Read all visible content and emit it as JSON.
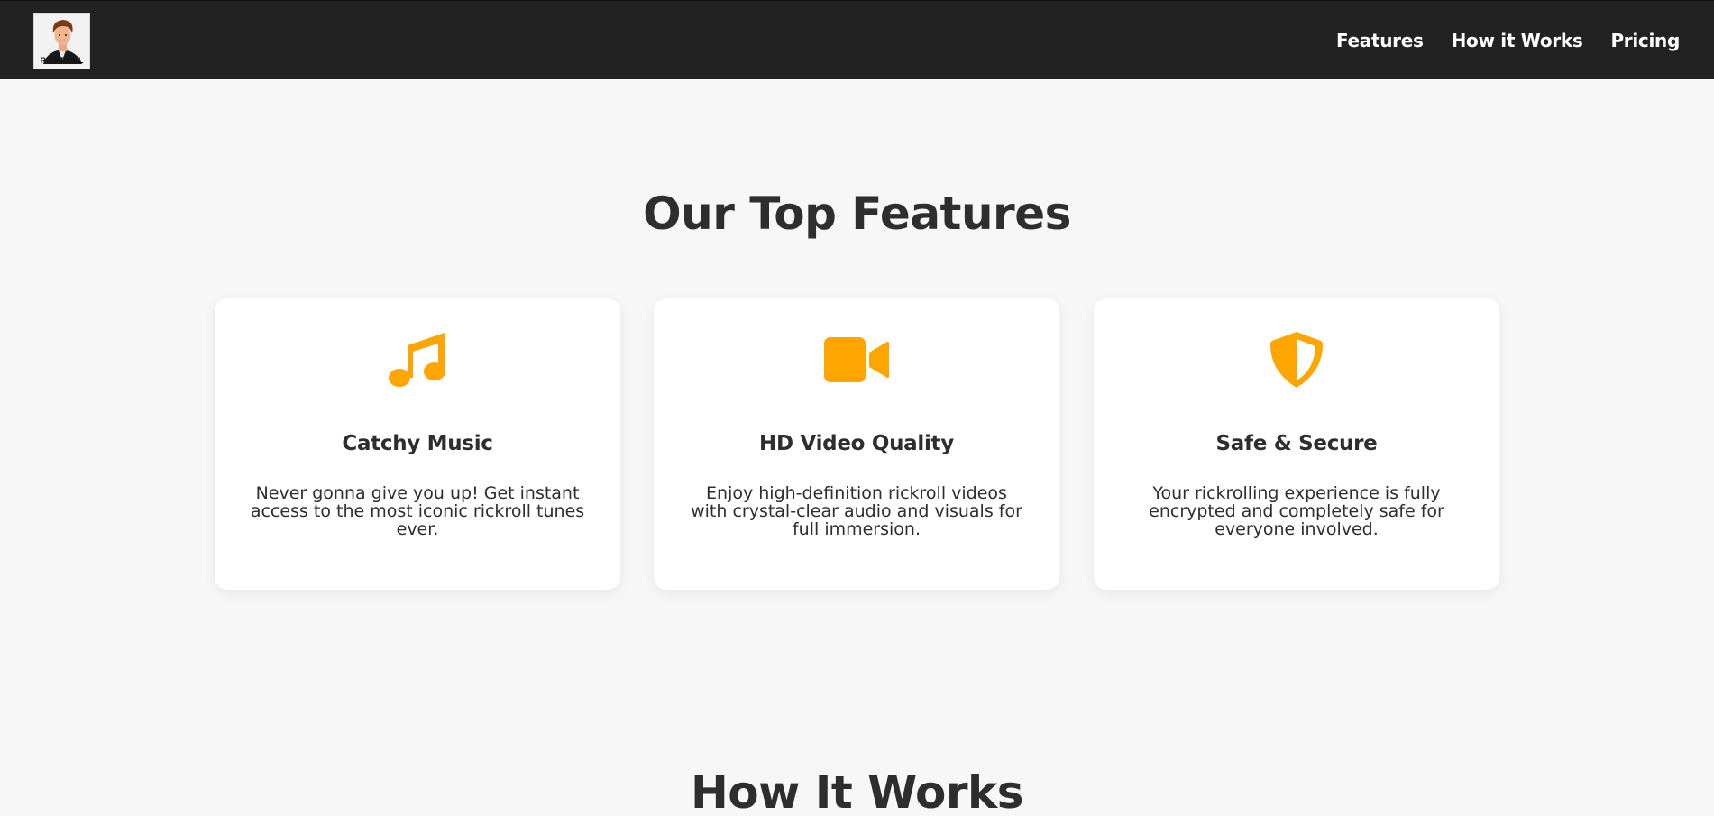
{
  "nav": {
    "logo_text": "RICKROLL",
    "links": [
      "Features",
      "How it Works",
      "Pricing"
    ]
  },
  "features": {
    "title": "Our Top Features",
    "cards": [
      {
        "icon": "music-note-icon",
        "title": "Catchy Music",
        "text": "Never gonna give you up! Get instant access to the most iconic rickroll tunes ever."
      },
      {
        "icon": "video-camera-icon",
        "title": "HD Video Quality",
        "text": "Enjoy high-definition rickroll videos with crystal-clear audio and visuals for full immersion."
      },
      {
        "icon": "shield-icon",
        "title": "Safe & Secure",
        "text": "Your rickrolling experience is fully encrypted and completely safe for everyone involved."
      }
    ]
  },
  "how_it_works": {
    "title": "How It Works"
  },
  "colors": {
    "nav_bg": "#222222",
    "page_bg": "#f7f7f7",
    "accent": "#ffa500",
    "text": "#2e2e2e"
  }
}
